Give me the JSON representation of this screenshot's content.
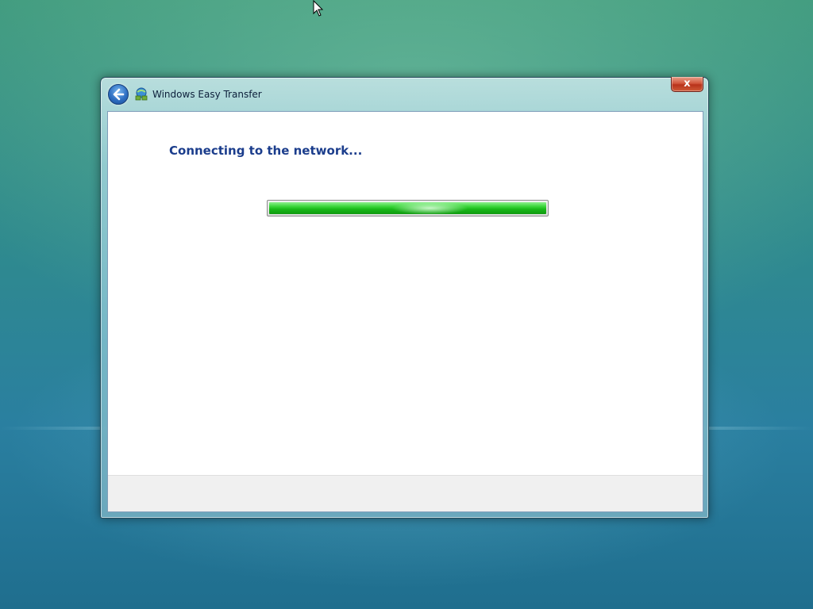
{
  "window": {
    "title": "Windows Easy Transfer",
    "close_label": "x"
  },
  "main": {
    "heading": "Connecting to the network...",
    "progress": {
      "percent": 100
    }
  },
  "icons": {
    "back": "back-arrow-icon",
    "app": "easy-transfer-icon",
    "close": "close-icon",
    "cursor": "mouse-cursor-icon"
  },
  "colors": {
    "heading": "#1b3d8c",
    "progress_fill": "#18b818",
    "close_button": "#c0391f"
  }
}
